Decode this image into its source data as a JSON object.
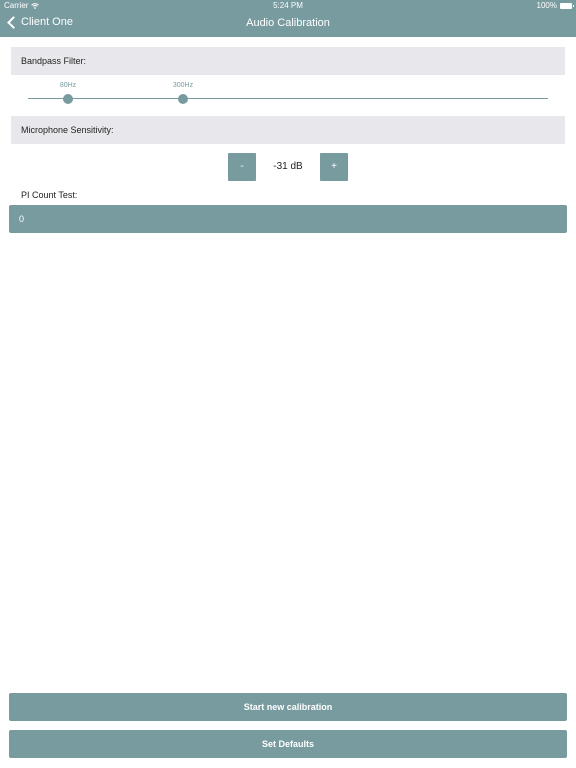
{
  "status_bar": {
    "carrier": "Carrier",
    "time": "5:24 PM",
    "battery": "100%"
  },
  "nav": {
    "back_label": "Client One",
    "title": "Audio Calibration"
  },
  "bandpass": {
    "header": "Bandpass Filter:",
    "low_label": "80Hz",
    "high_label": "300Hz"
  },
  "microphone": {
    "header": "Microphone Sensitivity:",
    "minus_label": "-",
    "plus_label": "+",
    "value": "-31 dB"
  },
  "pi_count": {
    "label": "PI Count Test:",
    "value": "0"
  },
  "actions": {
    "start_label": "Start new calibration",
    "defaults_label": "Set Defaults"
  },
  "colors": {
    "accent": "#789ba0",
    "section_bg": "#e8e8ec",
    "text": "#222222"
  }
}
